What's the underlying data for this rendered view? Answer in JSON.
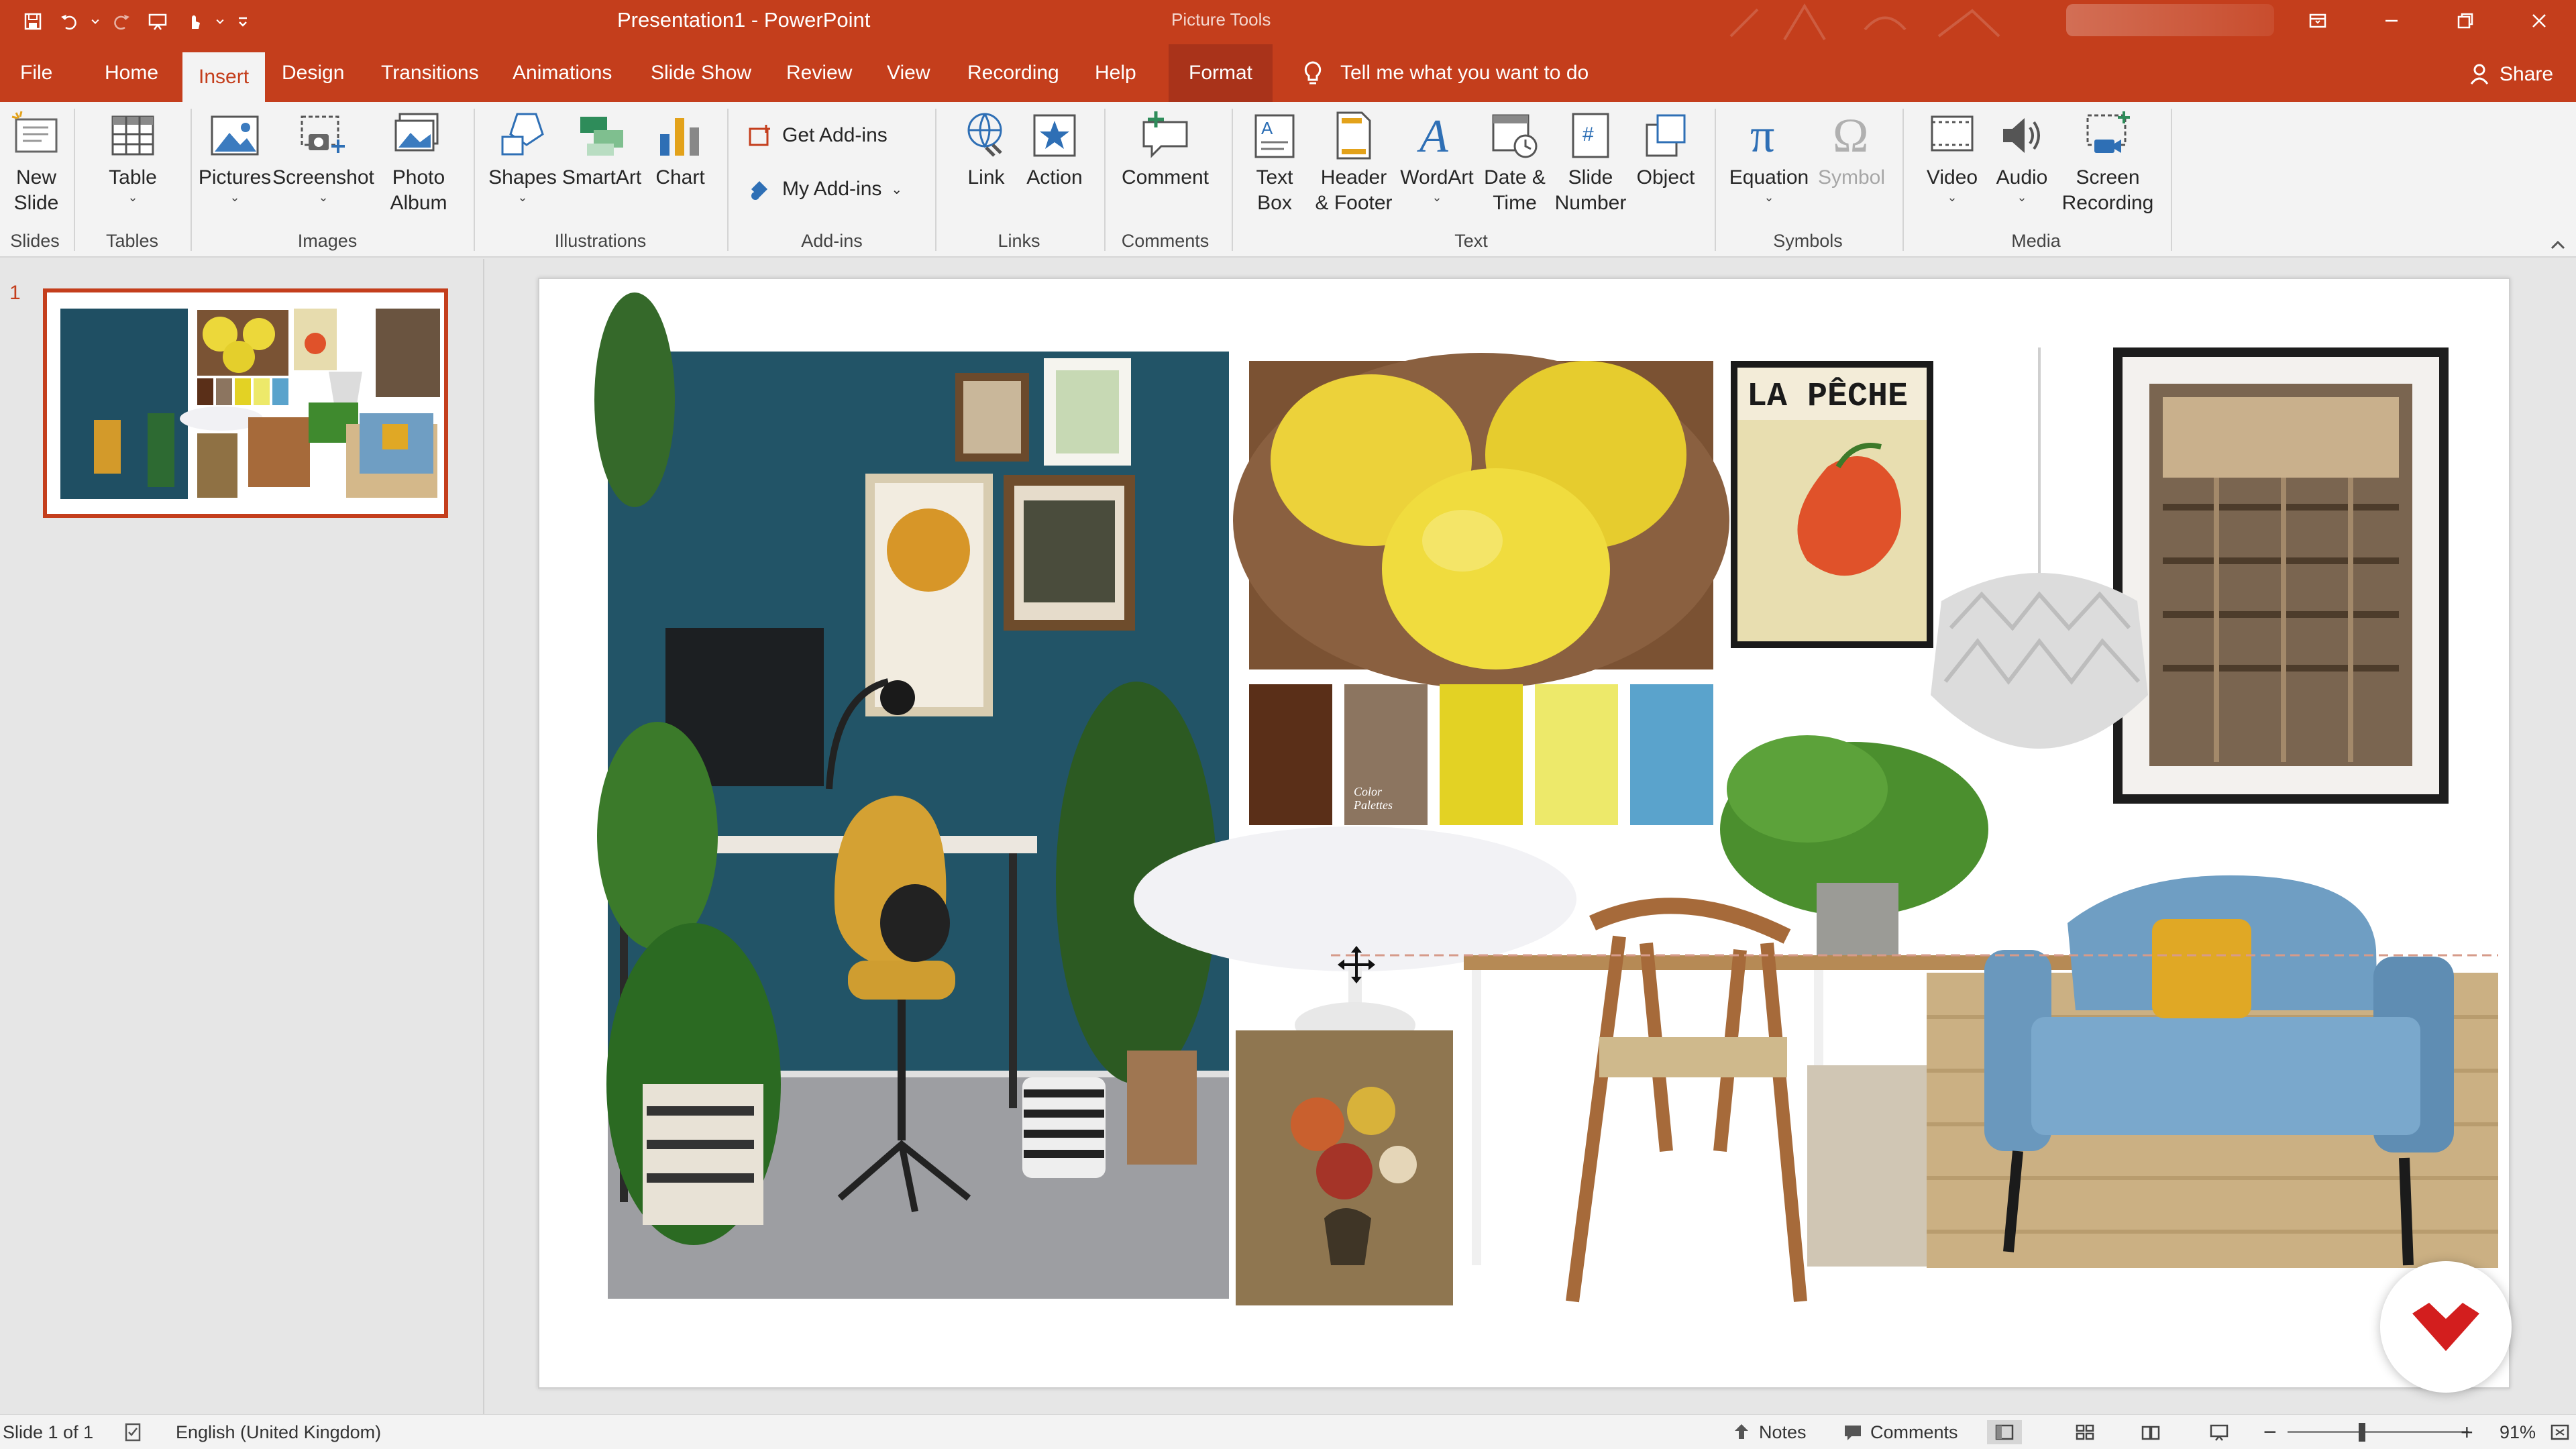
{
  "window": {
    "title": "Presentation1  -  PowerPoint",
    "context_tool": "Picture Tools"
  },
  "tabs": [
    "File",
    "Home",
    "Insert",
    "Design",
    "Transitions",
    "Animations",
    "Slide Show",
    "Review",
    "View",
    "Recording",
    "Help",
    "Format"
  ],
  "active_tab": "Insert",
  "tell_me": "Tell me what you want to do",
  "share": "Share",
  "ribbon": {
    "new_slide": [
      "New",
      "Slide"
    ],
    "table": "Table",
    "pictures": "Pictures",
    "screenshot": "Screenshot",
    "photo_album": [
      "Photo",
      "Album"
    ],
    "shapes": "Shapes",
    "smartart": "SmartArt",
    "chart": "Chart",
    "get_addins": "Get Add-ins",
    "my_addins": "My Add-ins",
    "link": "Link",
    "action": "Action",
    "comment": "Comment",
    "text_box": [
      "Text",
      "Box"
    ],
    "header_footer": [
      "Header",
      "& Footer"
    ],
    "wordart": "WordArt",
    "date_time": [
      "Date &",
      "Time"
    ],
    "slide_number": [
      "Slide",
      "Number"
    ],
    "object": "Object",
    "equation": "Equation",
    "symbol": "Symbol",
    "video": "Video",
    "audio": "Audio",
    "screen_recording": [
      "Screen",
      "Recording"
    ],
    "groups": {
      "slides": "Slides",
      "tables": "Tables",
      "images": "Images",
      "illustrations": "Illustrations",
      "addins": "Add-ins",
      "links": "Links",
      "comments": "Comments",
      "text": "Text",
      "symbols": "Symbols",
      "media": "Media"
    }
  },
  "thumbnail": {
    "slide_number": "1"
  },
  "slide": {
    "poster_title": "LA PÊCHE",
    "swatch_caption": [
      "Color",
      "Palettes"
    ],
    "palette": [
      "#5a2f18",
      "#8c7560",
      "#e3d224",
      "#ede96a",
      "#5aa3cc"
    ]
  },
  "status": {
    "slide_count": "Slide 1 of 1",
    "language": "English (United Kingdom)",
    "notes": "Notes",
    "comments": "Comments",
    "zoom": "91%"
  },
  "colors": {
    "accent": "#c43e1c"
  }
}
